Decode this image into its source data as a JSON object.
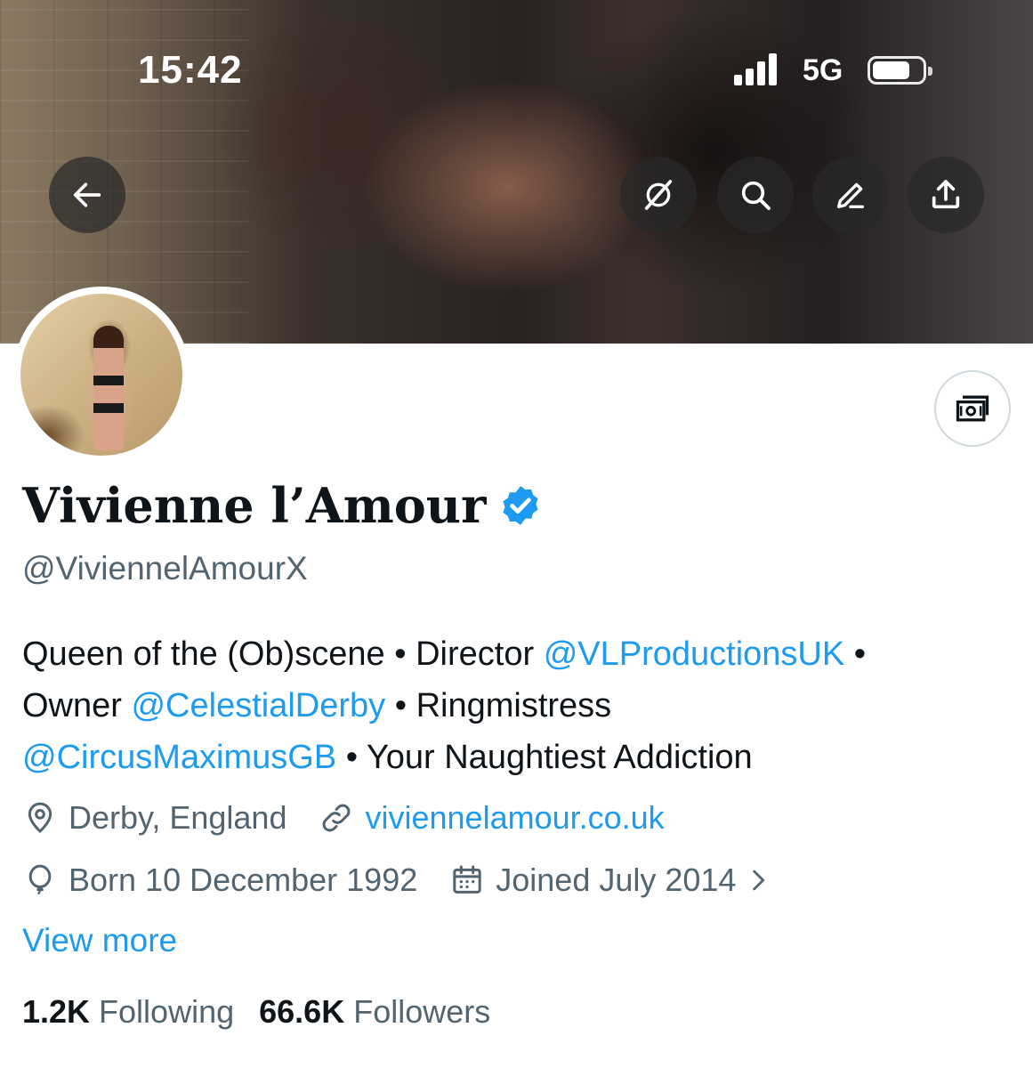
{
  "status_bar": {
    "time": "15:42",
    "network": "5G",
    "battery_level": 0.75
  },
  "banner": {
    "description_icons": [
      "back-arrow-icon",
      "grok-icon",
      "search-icon",
      "edit-icon",
      "share-icon"
    ]
  },
  "profile": {
    "name": "Vivienne l’Amour",
    "handle": "@ViviennelAmourX",
    "verified": true
  },
  "bio": {
    "line1": {
      "t1": "Queen of the (Ob)scene • Director ",
      "m1": "@VLProductionsUK",
      "t2": " •"
    },
    "line2": {
      "t1": "Owner ",
      "m1": "@CelestialDerby",
      "t2": " • Ringmistress"
    },
    "line3": {
      "m1": "@CircusMaximusGB",
      "t1": " • Your Naughtiest Addiction"
    }
  },
  "meta": {
    "location": "Derby, England",
    "website": "viviennelamour.co.uk",
    "born": "Born 10 December 1992",
    "joined": "Joined July 2014"
  },
  "view_more": "View more",
  "stats": {
    "following_count": "1.2K",
    "following_label": "Following",
    "followers_count": "66.6K",
    "followers_label": "Followers"
  },
  "colors": {
    "accent": "#1d9bf0",
    "secondary_text": "#536471",
    "primary_text": "#0f1419"
  }
}
